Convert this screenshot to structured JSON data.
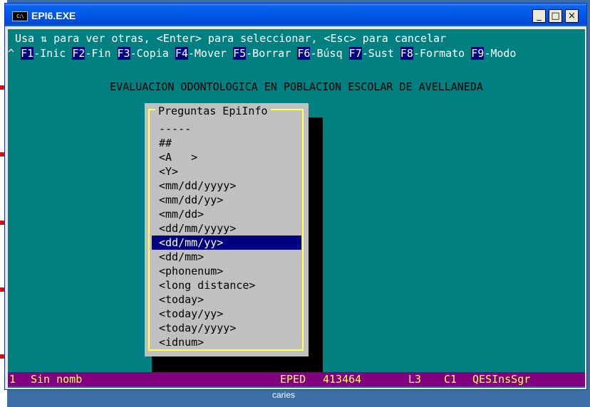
{
  "window": {
    "title": "EPI6.EXE",
    "icon_label": "C:\\",
    "minimize_glyph": "_",
    "maximize_glyph": "□",
    "close_glyph": "×"
  },
  "console": {
    "hint": "Usa ⇅ para ver otras, <Enter> para seleccionar, <Esc> para cancelar",
    "fkeys": [
      {
        "prefix": "^ ",
        "key": "F1",
        "label": "-Inic "
      },
      {
        "prefix": "",
        "key": "F2",
        "label": "-Fin "
      },
      {
        "prefix": "",
        "key": "F3",
        "label": "-Copia "
      },
      {
        "prefix": "",
        "key": "F4",
        "label": "-Mover "
      },
      {
        "prefix": "",
        "key": "F5",
        "label": "-Borrar "
      },
      {
        "prefix": "",
        "key": "F6",
        "label": "-Búsq "
      },
      {
        "prefix": "",
        "key": "F7",
        "label": "-Sust "
      },
      {
        "prefix": "",
        "key": "F8",
        "label": "-Formato "
      },
      {
        "prefix": "",
        "key": "F9",
        "label": "-Modo"
      }
    ],
    "screen_title": "EVALUACION ODONTOLOGICA EN POBLACION ESCOLAR DE AVELLANEDA"
  },
  "dialog": {
    "title": "Preguntas EpiInfo",
    "items": [
      "-----",
      "##",
      "<A   >",
      "<Y>",
      "<mm/dd/yyyy>",
      "<mm/dd/yy>",
      "<mm/dd>",
      "<dd/mm/yyyy>",
      "<dd/mm/yy>",
      "<dd/mm>",
      "<phonenum>",
      "<long distance>",
      "<today>",
      "<today/yy>",
      "<today/yyyy>",
      "<idnum>"
    ],
    "selected_index": 8
  },
  "status": {
    "page": "1",
    "name": "Sin nomb",
    "mode": "EPED",
    "memory": "413464",
    "line": "L3",
    "column": "C1",
    "flags": "QESInsSgr"
  },
  "desktop": {
    "caption": "caries"
  },
  "colors": {
    "console_bg": "#008080",
    "fkey_bg": "#000080",
    "dialog_bg": "#c0c0c0",
    "dialog_border": "#ffff55",
    "selection_bg": "#000080",
    "status_bg": "#800080",
    "status_fg": "#ffff55"
  }
}
